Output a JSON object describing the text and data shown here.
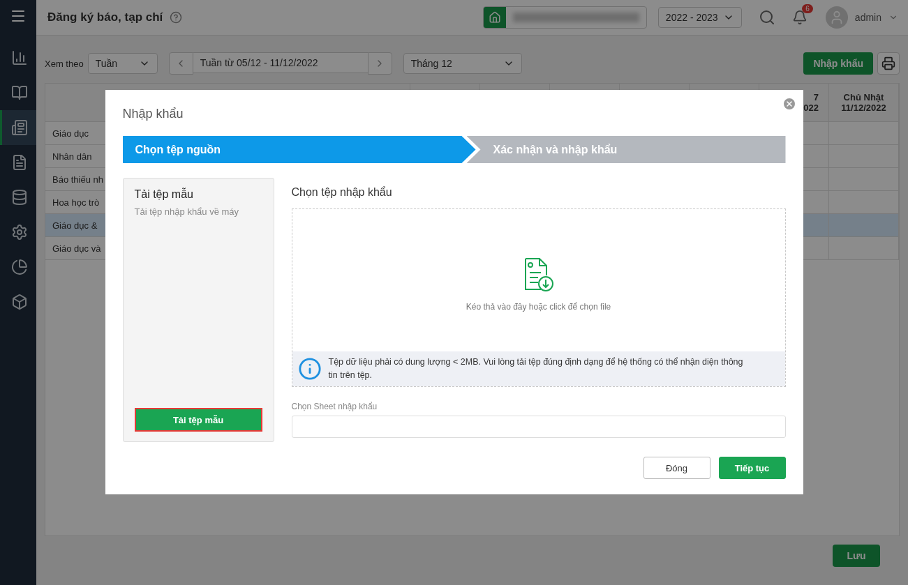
{
  "sidebar": {
    "items": [
      {
        "selected": false
      },
      {
        "selected": false
      },
      {
        "selected": true
      },
      {
        "selected": false
      },
      {
        "selected": false
      },
      {
        "selected": false
      },
      {
        "selected": false
      },
      {
        "selected": false
      }
    ]
  },
  "header": {
    "title": "Đăng ký báo, tạp chí",
    "year": "2022 - 2023",
    "notifications": "6",
    "user": "admin"
  },
  "toolbar": {
    "view_label": "Xem theo",
    "view": "Tuần",
    "week": "Tuần từ 05/12 - 11/12/2022",
    "month": "Tháng 12",
    "import_button": "Nhập khẩu"
  },
  "table": {
    "columns": [
      {
        "lines": [
          "7",
          "022"
        ]
      },
      {
        "lines": [
          "Chủ Nhật",
          "11/12/2022"
        ]
      }
    ],
    "rows": [
      {
        "name": "Giáo dục",
        "selected": false
      },
      {
        "name": "Nhân dân",
        "selected": false
      },
      {
        "name": "Báo thiếu nh",
        "selected": false
      },
      {
        "name": "Hoa học trò",
        "selected": false
      },
      {
        "name": "Giáo dục &",
        "selected": true
      },
      {
        "name": "Giáo dục và",
        "selected": false
      }
    ]
  },
  "save_button": "Lưu",
  "dialog": {
    "title": "Nhập khẩu",
    "steps": [
      {
        "label": "Chọn tệp nguồn",
        "selected": true
      },
      {
        "label": "Xác nhận và nhập khẩu",
        "selected": false
      }
    ],
    "template": {
      "title": "Tải tệp mẫu",
      "subtitle": "Tải tệp nhập khẩu về máy",
      "button": "Tải tệp mẫu"
    },
    "file_heading": "Chọn tệp nhập khẩu",
    "drop_hint": "Kéo thả vào đây hoặc click để chọn file",
    "info": "Tệp dữ liệu phải có dung lượng < 2MB. Vui lòng tải tệp đúng định dạng để hệ thống có thể nhận diện thông tin trên tệp.",
    "sheet_label": "Chọn Sheet nhập khẩu",
    "buttons": [
      {
        "label": "Đóng",
        "kind": "secondary"
      },
      {
        "label": "Tiếp tục",
        "kind": "primary"
      }
    ]
  }
}
